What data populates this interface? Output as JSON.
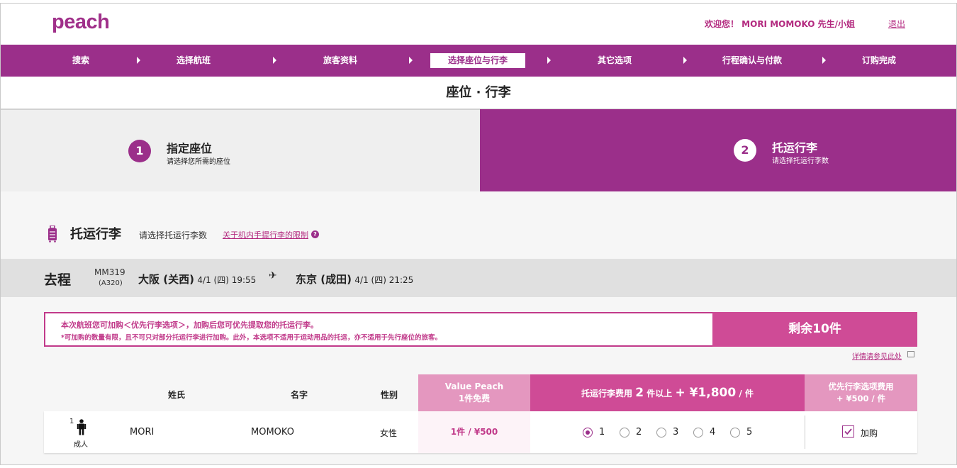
{
  "header": {
    "logo": "peach",
    "welcome": "欢迎您！ MORI MOMOKO 先生/小姐",
    "logout": "退出"
  },
  "steps": [
    {
      "label": "搜索",
      "active": false
    },
    {
      "label": "选择航班",
      "active": false
    },
    {
      "label": "旅客资料",
      "active": false
    },
    {
      "label": "选择座位与行李",
      "active": true
    },
    {
      "label": "其它选项",
      "active": false
    },
    {
      "label": "行程确认与付款",
      "active": false
    },
    {
      "label": "订购完成",
      "active": false
    }
  ],
  "page_title": "座位 · 行李",
  "sub_steps": [
    {
      "num": "1",
      "title": "指定座位",
      "desc": "请选择您所需的座位"
    },
    {
      "num": "2",
      "title": "托运行李",
      "desc": "请选择托运行李数"
    }
  ],
  "section": {
    "icon": "luggage-icon",
    "title": "托运行李",
    "desc": "请选择托运行李数",
    "link": "关于机内手提行李的限制",
    "help": "?"
  },
  "flight": {
    "direction": "去程",
    "number": "MM319",
    "aircraft": "(A320)",
    "dep_city": "大阪 (关西)",
    "dep_time": "4/1 (四) 19:55",
    "arr_city": "东京 (成田)",
    "arr_time": "4/1 (四) 21:25"
  },
  "notice": {
    "line1": "本次航班您可加购＜优先行李选项＞，加购后您可优先提取您的托运行李。",
    "line2": "*可加购的数量有限，且不可只对部分托运行李进行加购。此外，本选项不适用于运动用品的托运，亦不适用于先行座位的旅客。",
    "remaining": "剩余10件",
    "detail_link": "详情请参见此处"
  },
  "table": {
    "headers": {
      "surname": "姓氏",
      "given": "名字",
      "gender": "性别",
      "value_peach_l1": "Value Peach",
      "value_peach_l2": "1件免费",
      "fee_prefix": "托运行李费用",
      "fee_count": "2",
      "fee_mid": "件以上",
      "fee_price": "+ ¥1,800",
      "fee_unit": "/ 件",
      "prio_l1": "优先行李选项费用",
      "prio_l2": "+ ¥500 / 件"
    },
    "rows": [
      {
        "num": "1",
        "type": "成人",
        "surname": "MORI",
        "given": "MOMOKO",
        "gender": "女性",
        "value": "1件 / ¥500",
        "bag_options": [
          "1",
          "2",
          "3",
          "4",
          "5"
        ],
        "selected": "1",
        "add_label": "加购",
        "add_checked": true
      }
    ]
  },
  "colors": {
    "brand": "#9b2f8a",
    "pink": "#cf4b96",
    "light_pink": "#e497bf"
  }
}
